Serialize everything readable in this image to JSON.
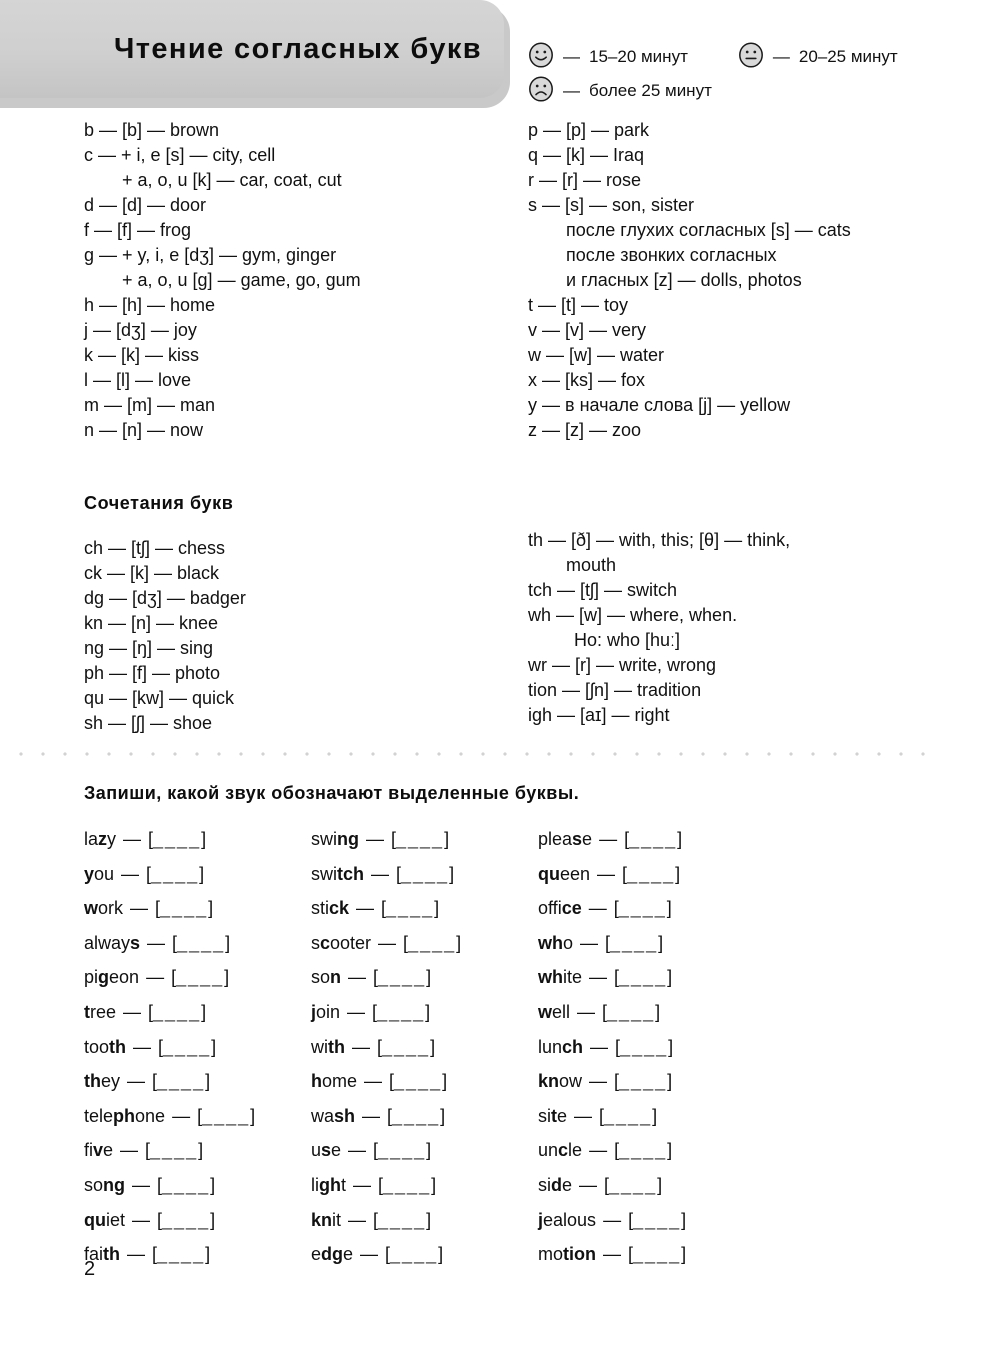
{
  "header": {
    "title": "Чтение согласных букв",
    "legend": [
      {
        "icon": "smiley-happy-icon",
        "dash": "—",
        "text": "15–20 минут"
      },
      {
        "icon": "smiley-neutral-icon",
        "dash": "—",
        "text": "20–25 минут"
      },
      {
        "icon": "smiley-sad-icon",
        "dash": "—",
        "text": "более 25 минут"
      }
    ]
  },
  "consonants": {
    "left": [
      {
        "text": "b — [b] — brown",
        "indent": 0
      },
      {
        "text": "c — + i, e [s] — city, cell",
        "indent": 0
      },
      {
        "text": "+ a, o, u [k] — car, coat, cut",
        "indent": 1
      },
      {
        "text": "d — [d] — door",
        "indent": 0
      },
      {
        "text": "f — [f] — frog",
        "indent": 0
      },
      {
        "text": "g — + y, i, e [dʒ] — gym, ginger",
        "indent": 0
      },
      {
        "text": "+ a, o, u [g] — game, go, gum",
        "indent": 1
      },
      {
        "text": "h — [h] — home",
        "indent": 0
      },
      {
        "text": "j — [dʒ] — joy",
        "indent": 0
      },
      {
        "text": "k — [k] — kiss",
        "indent": 0
      },
      {
        "text": "l — [l] — love",
        "indent": 0
      },
      {
        "text": "m — [m] — man",
        "indent": 0
      },
      {
        "text": "n — [n] — now",
        "indent": 0
      }
    ],
    "right": [
      {
        "text": "p — [p] — park",
        "indent": 0
      },
      {
        "text": "q — [k] — Iraq",
        "indent": 0
      },
      {
        "text": "r — [r] — rose",
        "indent": 0
      },
      {
        "text": "s — [s] — son, sister",
        "indent": 0
      },
      {
        "text": "после глухих согласных [s] — cats",
        "indent": 1
      },
      {
        "text": "после звонких согласных",
        "indent": 1
      },
      {
        "text": "и гласных [z] — dolls, photos",
        "indent": 1
      },
      {
        "text": "t — [t] — toy",
        "indent": 0
      },
      {
        "text": "v — [v] — very",
        "indent": 0
      },
      {
        "text": "w — [w] — water",
        "indent": 0
      },
      {
        "text": "x — [ks] — fox",
        "indent": 0
      },
      {
        "text": "y — в начале слова [j] — yellow",
        "indent": 0
      },
      {
        "text": "z — [z] — zoo",
        "indent": 0
      }
    ]
  },
  "combinations": {
    "heading": "Сочетания букв",
    "left": [
      {
        "text": "ch — [tʃ] — chess",
        "indent": 0
      },
      {
        "text": "ck — [k] — black",
        "indent": 0
      },
      {
        "text": "dg — [dʒ] — badger",
        "indent": 0
      },
      {
        "text": "kn — [n] — knee",
        "indent": 0
      },
      {
        "text": "ng — [ŋ] — sing",
        "indent": 0
      },
      {
        "text": "ph — [f] — photo",
        "indent": 0
      },
      {
        "text": "qu — [kw] — quick",
        "indent": 0
      },
      {
        "text": "sh — [ʃ] — shoe",
        "indent": 0
      }
    ],
    "right": [
      {
        "text": "th — [ð] — with, this; [θ] — think,",
        "indent": 0
      },
      {
        "text": "mouth",
        "indent": 1
      },
      {
        "text": "tch — [tʃ] — switch",
        "indent": 0
      },
      {
        "text": "wh — [w] — where, when.",
        "indent": 0
      },
      {
        "text": "Но: who [huː]",
        "indent": 2
      },
      {
        "text": "wr — [r] — write, wrong",
        "indent": 0
      },
      {
        "text": "tion — [ʃn] — tradition",
        "indent": 0
      },
      {
        "text": "igh — [aɪ] — right",
        "indent": 0
      }
    ]
  },
  "exercise": {
    "title": "Запиши, какой звук обозначают выделенные буквы.",
    "dash": "—",
    "blank": "[____]",
    "columns": [
      [
        {
          "pre": "la",
          "bold": "z",
          "post": "y"
        },
        {
          "pre": "",
          "bold": "y",
          "post": "ou"
        },
        {
          "pre": "",
          "bold": "w",
          "post": "ork"
        },
        {
          "pre": "alway",
          "bold": "s",
          "post": ""
        },
        {
          "pre": "pi",
          "bold": "g",
          "post": "eon"
        },
        {
          "pre": "",
          "bold": "t",
          "post": "ree"
        },
        {
          "pre": "too",
          "bold": "th",
          "post": ""
        },
        {
          "pre": "",
          "bold": "th",
          "post": "ey"
        },
        {
          "pre": "tele",
          "bold": "ph",
          "post": "one"
        },
        {
          "pre": "fi",
          "bold": "v",
          "post": "e"
        },
        {
          "pre": "so",
          "bold": "ng",
          "post": ""
        },
        {
          "pre": "",
          "bold": "qu",
          "post": "iet"
        },
        {
          "pre": "fai",
          "bold": "th",
          "post": ""
        }
      ],
      [
        {
          "pre": "swi",
          "bold": "ng",
          "post": ""
        },
        {
          "pre": "swi",
          "bold": "tch",
          "post": ""
        },
        {
          "pre": "sti",
          "bold": "ck",
          "post": ""
        },
        {
          "pre": "s",
          "bold": "c",
          "post": "ooter"
        },
        {
          "pre": "so",
          "bold": "n",
          "post": ""
        },
        {
          "pre": "",
          "bold": "j",
          "post": "oin"
        },
        {
          "pre": "wi",
          "bold": "th",
          "post": ""
        },
        {
          "pre": "",
          "bold": "h",
          "post": "ome"
        },
        {
          "pre": "wa",
          "bold": "sh",
          "post": ""
        },
        {
          "pre": "u",
          "bold": "s",
          "post": "e"
        },
        {
          "pre": "li",
          "bold": "gh",
          "post": "t"
        },
        {
          "pre": "",
          "bold": "kn",
          "post": "it"
        },
        {
          "pre": "e",
          "bold": "dg",
          "post": "e"
        }
      ],
      [
        {
          "pre": "plea",
          "bold": "s",
          "post": "e"
        },
        {
          "pre": "",
          "bold": "qu",
          "post": "een"
        },
        {
          "pre": "offi",
          "bold": "ce",
          "post": ""
        },
        {
          "pre": "",
          "bold": "wh",
          "post": "o"
        },
        {
          "pre": "",
          "bold": "wh",
          "post": "ite"
        },
        {
          "pre": "",
          "bold": "w",
          "post": "ell"
        },
        {
          "pre": "lun",
          "bold": "ch",
          "post": ""
        },
        {
          "pre": "",
          "bold": "kn",
          "post": "ow"
        },
        {
          "pre": "si",
          "bold": "t",
          "post": "e"
        },
        {
          "pre": "un",
          "bold": "c",
          "post": "le"
        },
        {
          "pre": "si",
          "bold": "d",
          "post": "e"
        },
        {
          "pre": "",
          "bold": "j",
          "post": "ealous"
        },
        {
          "pre": "mo",
          "bold": "tion",
          "post": ""
        }
      ]
    ]
  },
  "footer": {
    "page_number": "2"
  },
  "colors": {
    "banner": "#cfcfcf",
    "banner_shadow": "#c9c9c9",
    "text": "#111111",
    "divider_dot": "#d2d2d2",
    "face_fill": "#d9d9d9"
  }
}
